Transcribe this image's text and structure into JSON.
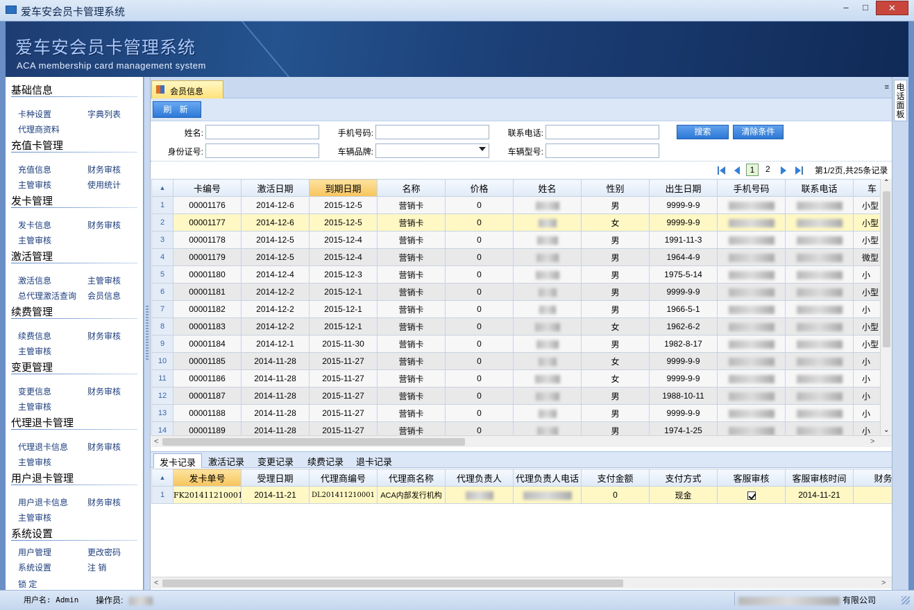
{
  "window": {
    "title": "爱车安会员卡管理系统"
  },
  "banner": {
    "title_cn": "爱车安会员卡管理系统",
    "title_en": "ACA membership card management system"
  },
  "sidebar": {
    "groups": [
      {
        "title": "基础信息",
        "items": [
          "卡种设置",
          "字典列表",
          "代理商资料"
        ]
      },
      {
        "title": "充值卡管理",
        "items": [
          "充值信息",
          "财务审核",
          "主管审核",
          "使用统计"
        ]
      },
      {
        "title": "发卡管理",
        "items": [
          "发卡信息",
          "财务审核",
          "主管审核"
        ]
      },
      {
        "title": "激活管理",
        "items": [
          "激活信息",
          "主管审核",
          "总代理激活查询",
          "会员信息"
        ]
      },
      {
        "title": "续费管理",
        "items": [
          "续费信息",
          "财务审核",
          "主管审核"
        ]
      },
      {
        "title": "变更管理",
        "items": [
          "变更信息",
          "财务审核",
          "主管审核"
        ]
      },
      {
        "title": "代理退卡管理",
        "items": [
          "代理退卡信息",
          "财务审核",
          "主管审核"
        ]
      },
      {
        "title": "用户退卡管理",
        "items": [
          "用户退卡信息",
          "财务审核",
          "主管审核"
        ]
      },
      {
        "title": "系统设置",
        "items": [
          "用户管理",
          "更改密码",
          "系统设置",
          "注  销",
          "锁  定"
        ]
      }
    ]
  },
  "main": {
    "tab_label": "会员信息",
    "tab_menu": "≡",
    "refresh_label": "刷 新",
    "search": {
      "name_label": "姓名:",
      "phone_label": "手机号码:",
      "contact_label": "联系电话:",
      "id_label": "身份证号:",
      "brand_label": "车辆品牌:",
      "model_label": "车辆型号:",
      "search_btn": "搜索",
      "clear_btn": "清除条件"
    },
    "pager": {
      "page1": "1",
      "page2": "2",
      "summary": "第1/2页,共25条记录"
    }
  },
  "members": {
    "columns": [
      "卡编号",
      "激活日期",
      "到期日期",
      "名称",
      "价格",
      "姓名",
      "性别",
      "出生日期",
      "手机号码",
      "联系电话",
      "车"
    ],
    "rows": [
      {
        "no": "1",
        "card": "00001176",
        "act": "2014-12-6",
        "exp": "2015-12-5",
        "name": "营销卡",
        "price": "0",
        "sex": "男",
        "birth": "9999-9-9",
        "car": "小型"
      },
      {
        "no": "2",
        "card": "00001177",
        "act": "2014-12-6",
        "exp": "2015-12-5",
        "name": "营销卡",
        "price": "0",
        "sex": "女",
        "birth": "9999-9-9",
        "car": "小型"
      },
      {
        "no": "3",
        "card": "00001178",
        "act": "2014-12-5",
        "exp": "2015-12-4",
        "name": "营销卡",
        "price": "0",
        "sex": "男",
        "birth": "1991-11-3",
        "car": "小型"
      },
      {
        "no": "4",
        "card": "00001179",
        "act": "2014-12-5",
        "exp": "2015-12-4",
        "name": "营销卡",
        "price": "0",
        "sex": "男",
        "birth": "1964-4-9",
        "car": "微型"
      },
      {
        "no": "5",
        "card": "00001180",
        "act": "2014-12-4",
        "exp": "2015-12-3",
        "name": "营销卡",
        "price": "0",
        "sex": "男",
        "birth": "1975-5-14",
        "car": "小"
      },
      {
        "no": "6",
        "card": "00001181",
        "act": "2014-12-2",
        "exp": "2015-12-1",
        "name": "营销卡",
        "price": "0",
        "sex": "男",
        "birth": "9999-9-9",
        "car": "小型"
      },
      {
        "no": "7",
        "card": "00001182",
        "act": "2014-12-2",
        "exp": "2015-12-1",
        "name": "营销卡",
        "price": "0",
        "sex": "男",
        "birth": "1966-5-1",
        "car": "小"
      },
      {
        "no": "8",
        "card": "00001183",
        "act": "2014-12-2",
        "exp": "2015-12-1",
        "name": "营销卡",
        "price": "0",
        "sex": "女",
        "birth": "1962-6-2",
        "car": "小型"
      },
      {
        "no": "9",
        "card": "00001184",
        "act": "2014-12-1",
        "exp": "2015-11-30",
        "name": "营销卡",
        "price": "0",
        "sex": "男",
        "birth": "1982-8-17",
        "car": "小型"
      },
      {
        "no": "10",
        "card": "00001185",
        "act": "2014-11-28",
        "exp": "2015-11-27",
        "name": "营销卡",
        "price": "0",
        "sex": "女",
        "birth": "9999-9-9",
        "car": "小"
      },
      {
        "no": "11",
        "card": "00001186",
        "act": "2014-11-28",
        "exp": "2015-11-27",
        "name": "营销卡",
        "price": "0",
        "sex": "女",
        "birth": "9999-9-9",
        "car": "小"
      },
      {
        "no": "12",
        "card": "00001187",
        "act": "2014-11-28",
        "exp": "2015-11-27",
        "name": "营销卡",
        "price": "0",
        "sex": "男",
        "birth": "1988-10-11",
        "car": "小"
      },
      {
        "no": "13",
        "card": "00001188",
        "act": "2014-11-28",
        "exp": "2015-11-27",
        "name": "营销卡",
        "price": "0",
        "sex": "男",
        "birth": "9999-9-9",
        "car": "小"
      },
      {
        "no": "14",
        "card": "00001189",
        "act": "2014-11-28",
        "exp": "2015-11-27",
        "name": "营销卡",
        "price": "0",
        "sex": "男",
        "birth": "1974-1-25",
        "car": "小"
      }
    ]
  },
  "bottom": {
    "tabs": [
      "发卡记录",
      "激活记录",
      "变更记录",
      "续费记录",
      "退卡记录"
    ],
    "columns": [
      "发卡单号",
      "受理日期",
      "代理商编号",
      "代理商名称",
      "代理负责人",
      "代理负责人电话",
      "支付金额",
      "支付方式",
      "客服审核",
      "客服审核时间",
      "财务审"
    ],
    "rows": [
      {
        "no": "1",
        "order": "FK201411210001",
        "date": "2014-11-21",
        "agent_no": "DL201411210001",
        "agent_name": "ACA内部发行机构",
        "amount": "0",
        "pay": "现金",
        "cs_time": "2014-11-21"
      }
    ]
  },
  "right_panel": {
    "label": "电话面板"
  },
  "status": {
    "user": "用户名: Admin",
    "operator": "操作员:",
    "company": "有限公司"
  }
}
